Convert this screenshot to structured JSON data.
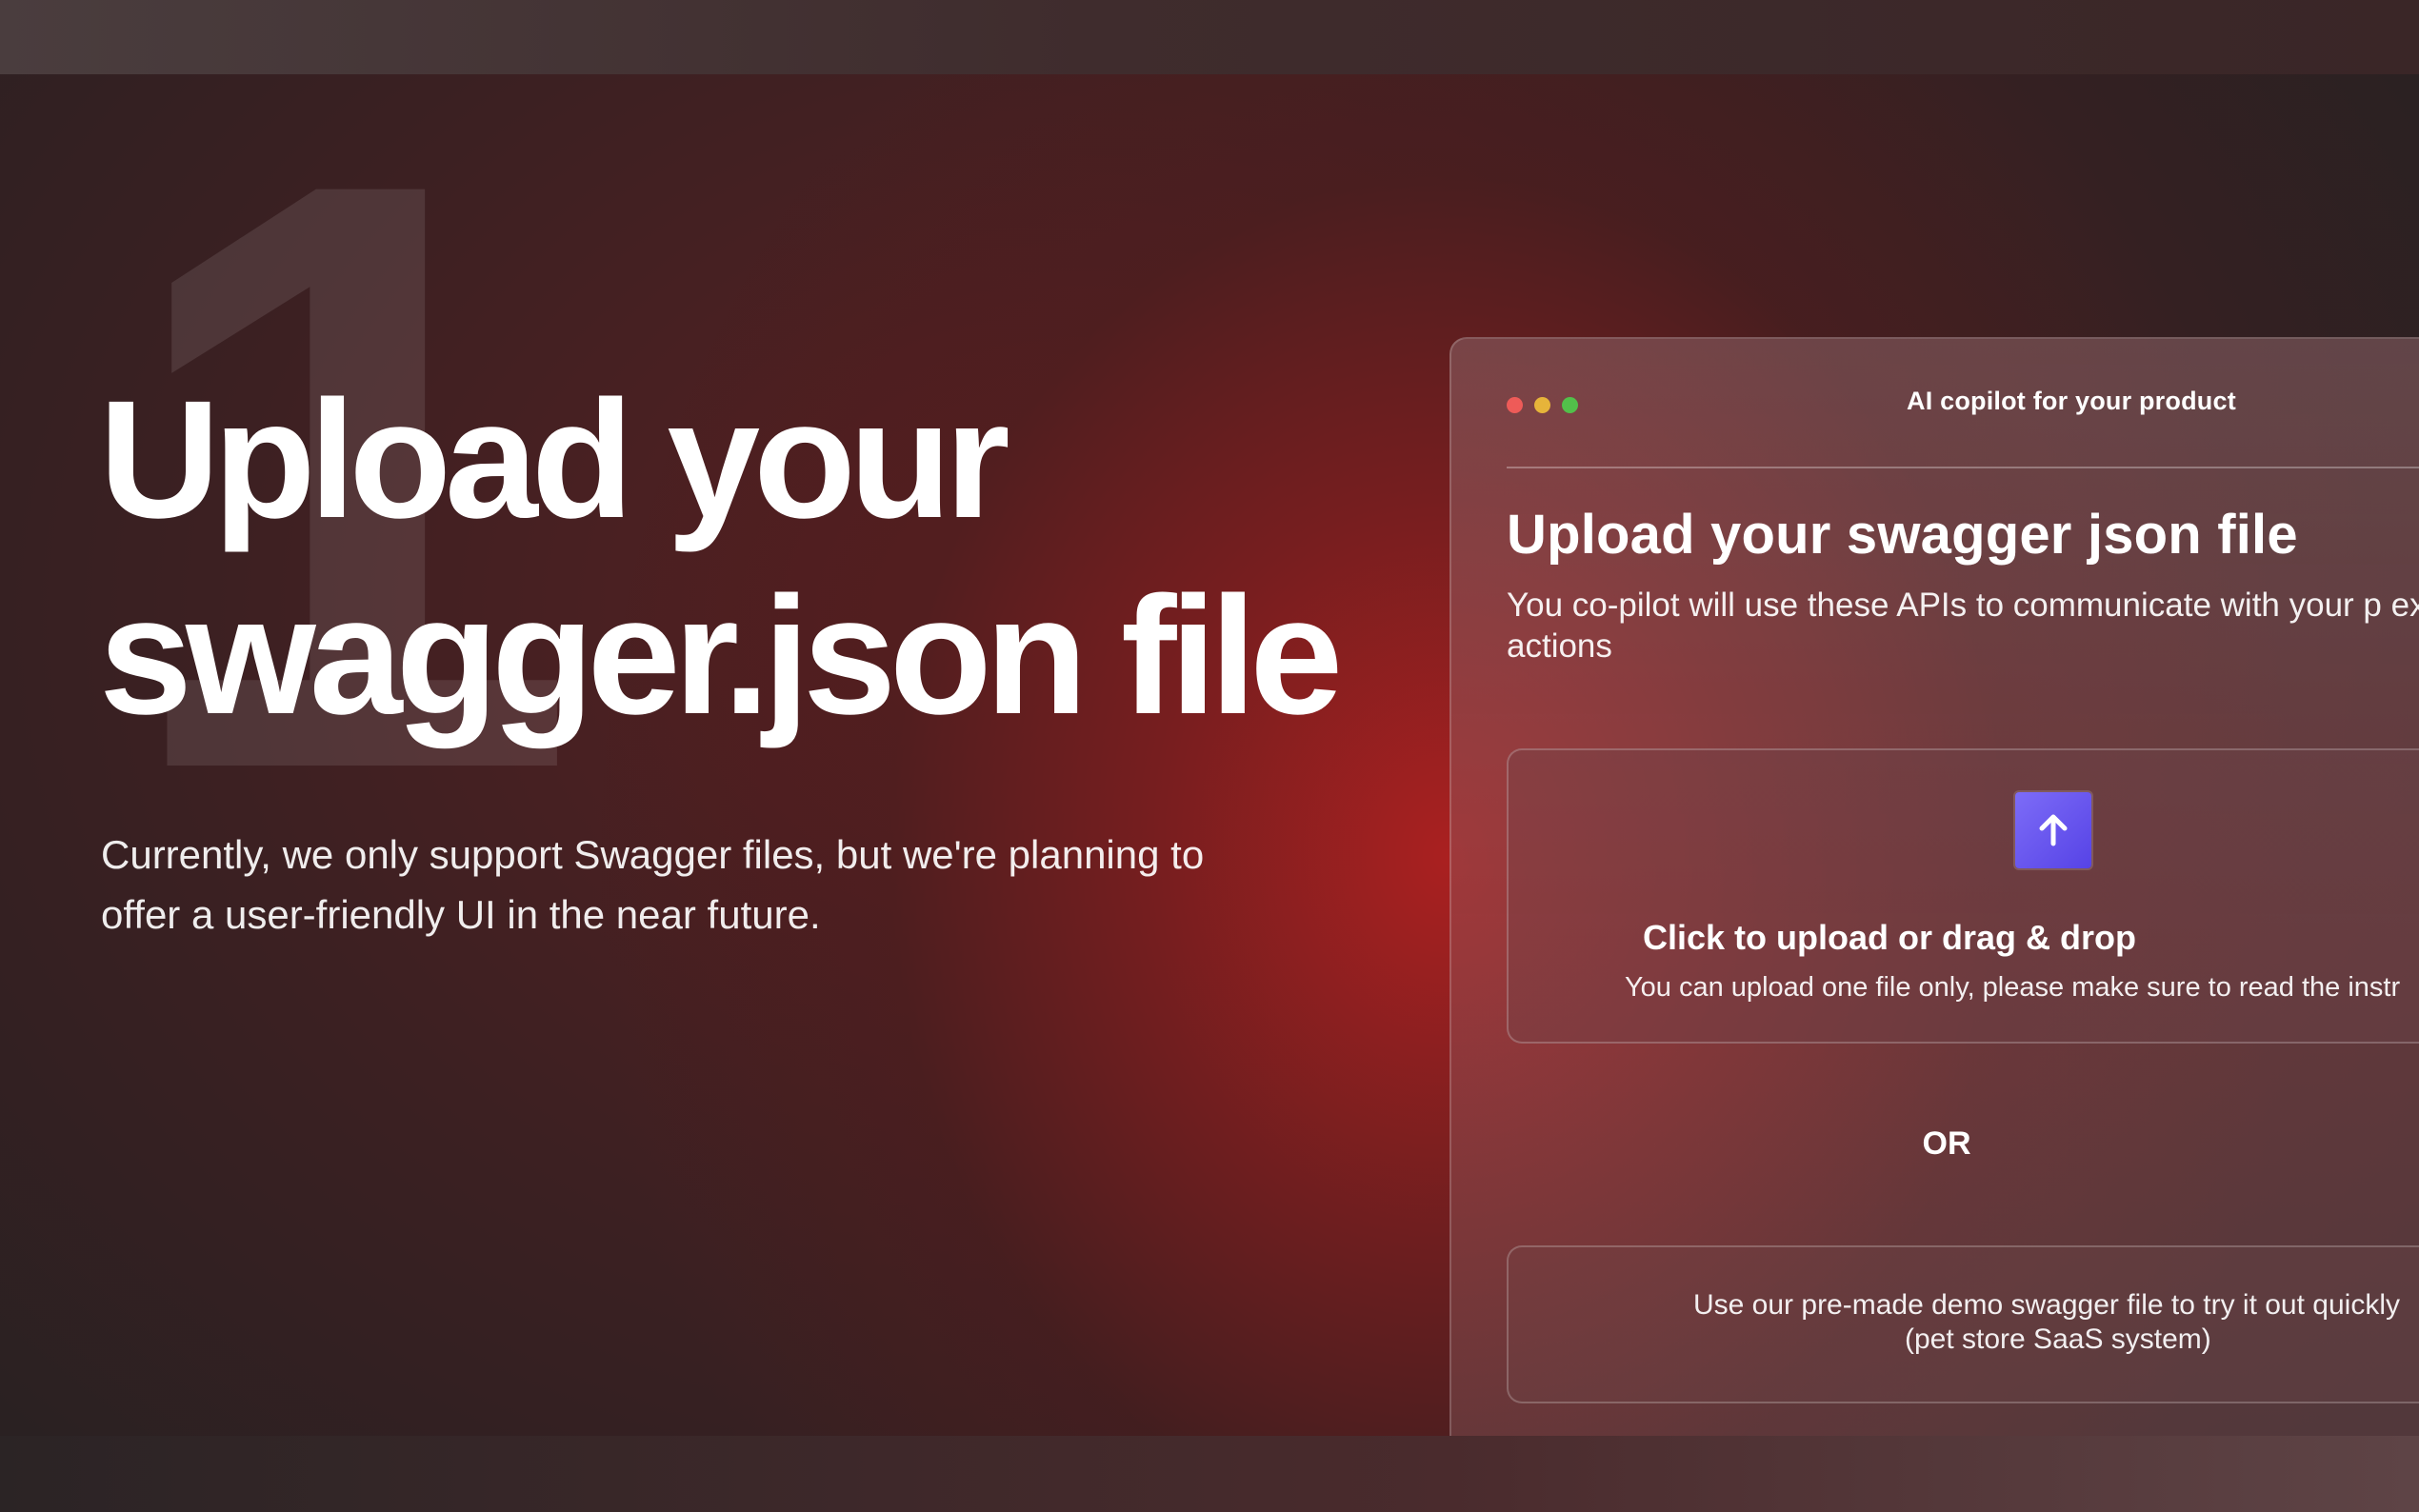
{
  "hero": {
    "step_number": "1",
    "headline_line1": "Upload your",
    "headline_line2": "swagger.json file",
    "description": "Currently, we only support Swagger files, but we're planning to offer a user-friendly UI in the near future."
  },
  "window": {
    "title": "AI copilot for your product",
    "heading": "Upload your swagger json file",
    "description": "You co-pilot will use these APIs to communicate with your p execute actions",
    "dropzone": {
      "icon": "upload-arrow-icon",
      "title": "Click to upload or drag & drop",
      "subtitle": "You can upload one file only, please make sure to read the instr"
    },
    "or_label": "OR",
    "demo_button": {
      "line1": "Use our pre-made demo swagger file to try it out quickly",
      "line2": "(pet store SaaS system)"
    }
  },
  "colors": {
    "background": "#3c2022",
    "glow": "#af2020",
    "upload_icon": "#6a57ef",
    "traffic_red": "#ee5b58",
    "traffic_yellow": "#e6b43a",
    "traffic_green": "#52c04a"
  }
}
